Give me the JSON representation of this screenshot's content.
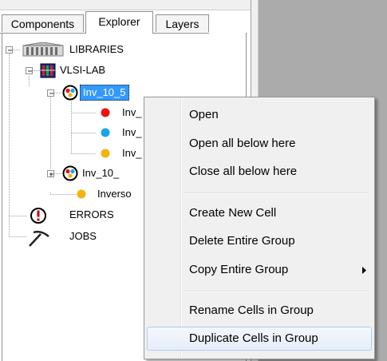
{
  "tabs": [
    {
      "label": "Components",
      "active": false
    },
    {
      "label": "Explorer",
      "active": true
    },
    {
      "label": "Layers",
      "active": false
    }
  ],
  "tree": {
    "libraries": "LIBRARIES",
    "vlsi_lab": "VLSI-LAB",
    "group_selected": "Inv_10_5",
    "cell_red": "Inv_",
    "cell_blue": "Inv_",
    "cell_orange": "Inv_",
    "group_2": "Inv_10_",
    "inverso": "Inverso",
    "errors": "ERRORS",
    "jobs": "JOBS"
  },
  "cell_colors": {
    "red": "#ee1111",
    "blue": "#1aa6e6",
    "orange": "#f5b20e"
  },
  "context_menu": {
    "items": [
      {
        "label": "Open",
        "has_submenu": false,
        "highlighted": false
      },
      {
        "label": "Open all below here",
        "has_submenu": false,
        "highlighted": false
      },
      {
        "label": "Close all below here",
        "has_submenu": false,
        "highlighted": false
      },
      {
        "label": "Create New Cell",
        "has_submenu": false,
        "highlighted": false
      },
      {
        "label": "Delete Entire Group",
        "has_submenu": false,
        "highlighted": false
      },
      {
        "label": "Copy Entire Group",
        "has_submenu": true,
        "highlighted": false
      },
      {
        "label": "Rename Cells in Group",
        "has_submenu": false,
        "highlighted": false
      },
      {
        "label": "Duplicate Cells in Group",
        "has_submenu": false,
        "highlighted": true
      }
    ]
  },
  "icons": {
    "libraries": "library-building-icon",
    "vlsi_lab": "library-book-icon",
    "group": "cell-group-icon",
    "errors": "error-icon",
    "jobs": "jobs-pickaxe-icon",
    "submenu": "submenu-arrow-icon"
  }
}
